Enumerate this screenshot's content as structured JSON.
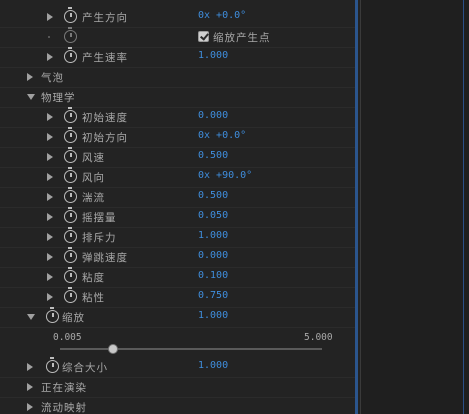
{
  "scrollbar_color": "#2d5ea0",
  "value_color": "#3f8ddc",
  "rows": [
    {
      "label": "产生方向",
      "value": "0x +0.0°",
      "indent": 2,
      "expander": "right",
      "stopwatch": true
    },
    {
      "label": "",
      "checkbox": true,
      "checkbox_label": "缩放产生点",
      "indent": 2,
      "expander": "none",
      "stopwatch": true,
      "stopwatch_dim": true
    },
    {
      "label": "产生速率",
      "value": "1.000",
      "indent": 2,
      "expander": "right",
      "stopwatch": true
    },
    {
      "label": "气泡",
      "indent": 1,
      "expander": "right",
      "stopwatch": false
    },
    {
      "label": "物理学",
      "indent": 1,
      "expander": "down",
      "stopwatch": false
    },
    {
      "label": "初始速度",
      "value": "0.000",
      "indent": 2,
      "expander": "right",
      "stopwatch": true
    },
    {
      "label": "初始方向",
      "value": "0x +0.0°",
      "indent": 2,
      "expander": "right",
      "stopwatch": true
    },
    {
      "label": "风速",
      "value": "0.500",
      "indent": 2,
      "expander": "right",
      "stopwatch": true
    },
    {
      "label": "风向",
      "value": "0x +90.0°",
      "indent": 2,
      "expander": "right",
      "stopwatch": true
    },
    {
      "label": "湍流",
      "value": "0.500",
      "indent": 2,
      "expander": "right",
      "stopwatch": true
    },
    {
      "label": "摇摆量",
      "value": "0.050",
      "indent": 2,
      "expander": "right",
      "stopwatch": true
    },
    {
      "label": "排斥力",
      "value": "1.000",
      "indent": 2,
      "expander": "right",
      "stopwatch": true
    },
    {
      "label": "弹跳速度",
      "value": "0.000",
      "indent": 2,
      "expander": "right",
      "stopwatch": true
    },
    {
      "label": "粘度",
      "value": "0.100",
      "indent": 2,
      "expander": "right",
      "stopwatch": true
    },
    {
      "label": "粘性",
      "value": "0.750",
      "indent": 2,
      "expander": "right",
      "stopwatch": true
    },
    {
      "label": "缩放",
      "value": "1.000",
      "indent": 1,
      "expander": "down",
      "stopwatch": true
    }
  ],
  "scale_slider": {
    "min_label": "0.005",
    "max_label": "5.000",
    "min": 0.005,
    "max": 5.0,
    "value": 1.0
  },
  "rows_after": [
    {
      "label": "综合大小",
      "value": "1.000",
      "indent": 1,
      "expander": "right",
      "stopwatch": true
    },
    {
      "label": "正在演染",
      "indent": 1,
      "expander": "right",
      "stopwatch": false
    },
    {
      "label": "流动映射",
      "indent": 1,
      "expander": "right",
      "stopwatch": false
    }
  ]
}
